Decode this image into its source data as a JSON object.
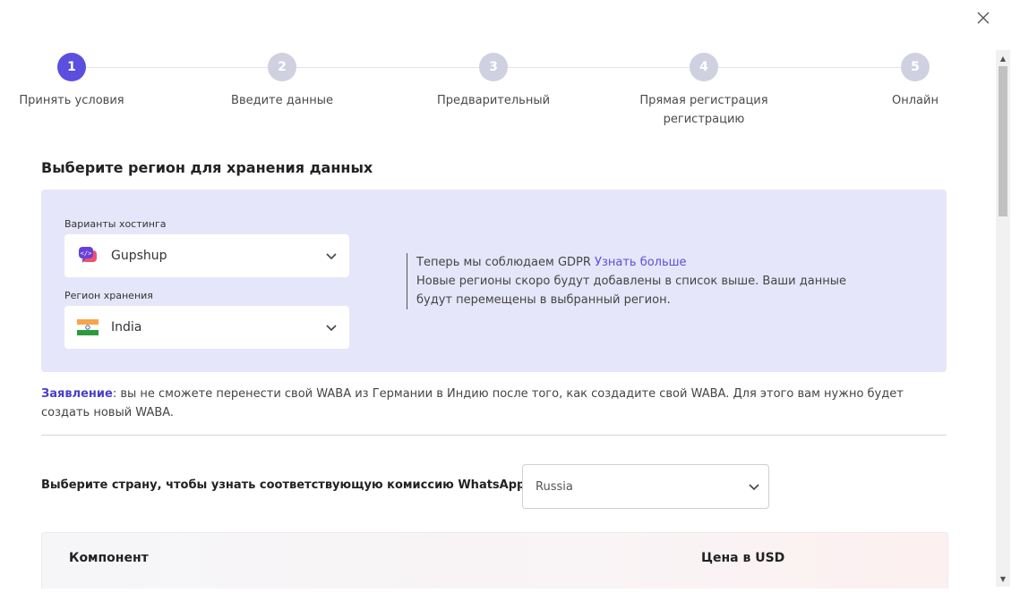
{
  "steps": [
    {
      "number": "1",
      "label": "Принять условия",
      "active": true
    },
    {
      "number": "2",
      "label": "Введите данные",
      "active": false
    },
    {
      "number": "3",
      "label": "Предварительный",
      "active": false
    },
    {
      "number": "4",
      "label_line1": "Прямая регистрация",
      "label_line2": "регистрацию",
      "active": false
    },
    {
      "number": "5",
      "label": "Онлайн",
      "active": false
    }
  ],
  "section": {
    "title": "Выберите регион для хранения данных"
  },
  "hosting": {
    "label": "Варианты хостинга",
    "value": "Gupshup",
    "icon": "gupshup-logo-icon"
  },
  "storage": {
    "label": "Регион хранения",
    "value": "India",
    "icon": "india-flag-icon"
  },
  "info": {
    "gdpr_text": "Теперь мы соблюдаем GDPR",
    "gdpr_link": "Узнать больше",
    "note": "Новые регионы скоро будут добавлены в список выше. Ваши данные будут перемещены в выбранный регион."
  },
  "statement": {
    "label": "Заявление",
    "text": ": вы не сможете перенести свой WABA из Германии в Индию после того, как создадите свой WABA. Для этого вам нужно будет создать новый WABA."
  },
  "country": {
    "label": "Выберите страну, чтобы узнать соответствующую комиссию WhatsApp",
    "value": "Russia"
  },
  "table": {
    "col_component": "Компонент",
    "col_price": "Цена в USD"
  },
  "colors": {
    "accent": "#5b4fe0",
    "panel_bg": "#e6e6fa",
    "step_inactive": "#cfd0e0"
  }
}
